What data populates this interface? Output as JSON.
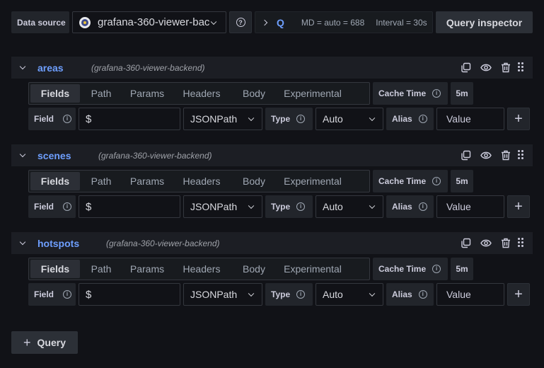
{
  "toolbar": {
    "datasource_label": "Data source",
    "datasource_value": "grafana-360-viewer-bac",
    "query_options_icon": "chevron-right-icon",
    "query_q": "Q",
    "md_text": "MD = auto = 688",
    "interval_text": "Interval = 30s",
    "inspector_label": "Query inspector"
  },
  "queries": [
    {
      "ref_id": "areas",
      "datasource": "(grafana-360-viewer-backend)",
      "tabs": [
        "Fields",
        "Path",
        "Params",
        "Headers",
        "Body",
        "Experimental"
      ],
      "cache_label": "Cache Time",
      "cache_value": "5m",
      "field_label": "Field",
      "field_value": "$",
      "field_type": "JSONPath",
      "type_label": "Type",
      "type_value": "Auto",
      "alias_label": "Alias",
      "alias_placeholder": "Value"
    },
    {
      "ref_id": "scenes",
      "datasource": "(grafana-360-viewer-backend)",
      "tabs": [
        "Fields",
        "Path",
        "Params",
        "Headers",
        "Body",
        "Experimental"
      ],
      "cache_label": "Cache Time",
      "cache_value": "5m",
      "field_label": "Field",
      "field_value": "$",
      "field_type": "JSONPath",
      "type_label": "Type",
      "type_value": "Auto",
      "alias_label": "Alias",
      "alias_placeholder": "Value"
    },
    {
      "ref_id": "hotspots",
      "datasource": "(grafana-360-viewer-backend)",
      "tabs": [
        "Fields",
        "Path",
        "Params",
        "Headers",
        "Body",
        "Experimental"
      ],
      "cache_label": "Cache Time",
      "cache_value": "5m",
      "field_label": "Field",
      "field_value": "$",
      "field_type": "JSONPath",
      "type_label": "Type",
      "type_value": "Auto",
      "alias_label": "Alias",
      "alias_placeholder": "Value"
    }
  ],
  "footer": {
    "add_query_label": "Query"
  }
}
